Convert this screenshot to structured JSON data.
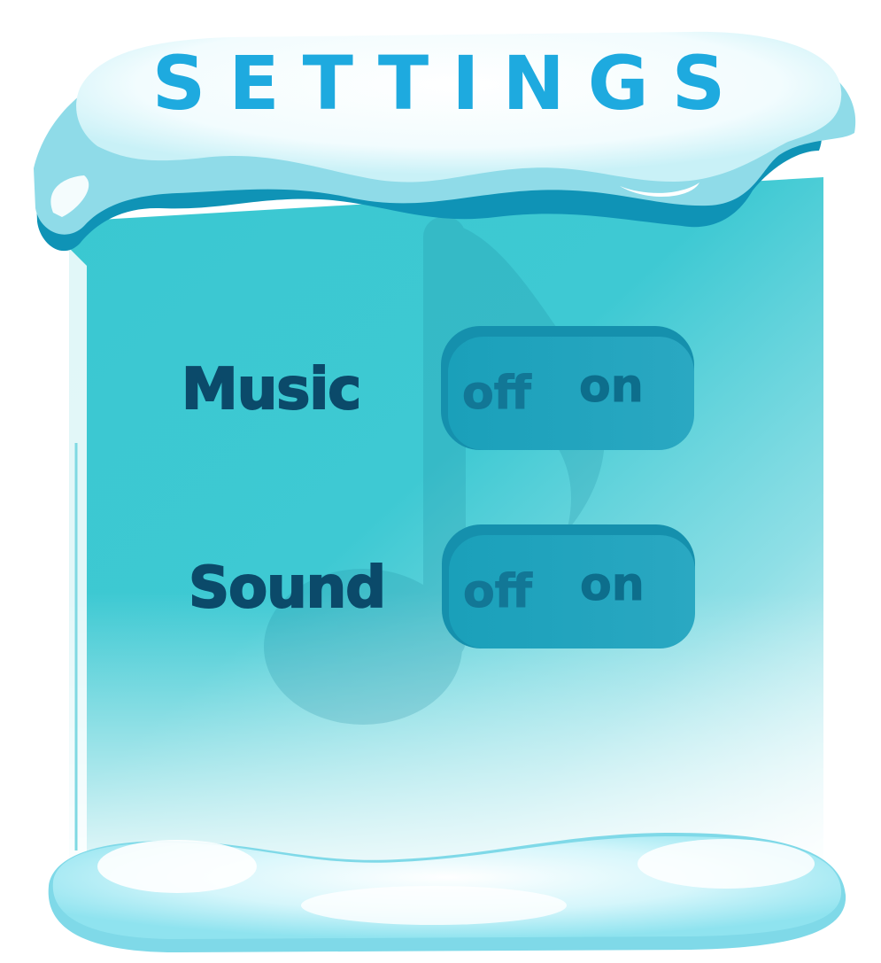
{
  "title": "SETTINGS",
  "settings": [
    {
      "label": "Music",
      "off_label": "off",
      "on_label": "on"
    },
    {
      "label": "Sound",
      "off_label": "off",
      "on_label": "on"
    }
  ],
  "colors": {
    "title": "#1eaadf",
    "label": "#0b4a6a",
    "panel": "#3cc9d2",
    "ice": "#b4edf4",
    "toggle": "#1aa0ba"
  },
  "icons": [
    "music-note-icon"
  ]
}
